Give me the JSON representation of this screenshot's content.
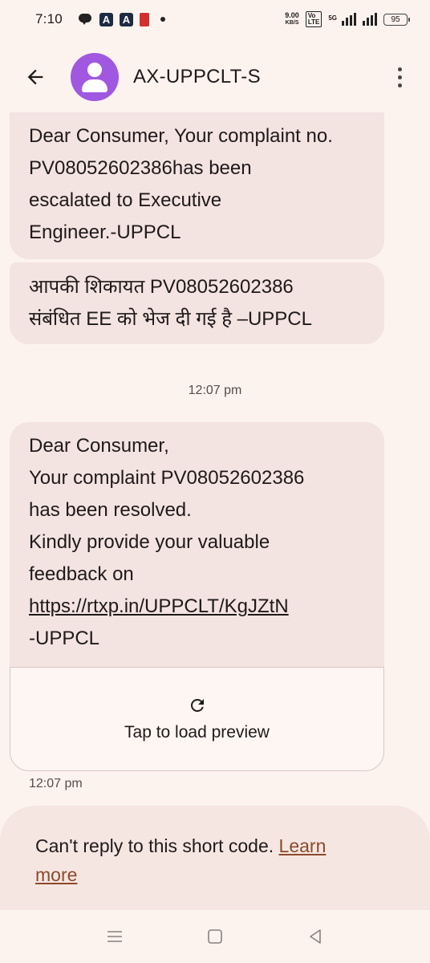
{
  "status_bar": {
    "time": "7:10",
    "net_speed_value": "9.00",
    "net_speed_unit": "KB/S",
    "volte_label_top": "Vo",
    "volte_label_bottom": "LTE",
    "network_type": "5G",
    "battery": "95"
  },
  "header": {
    "contact_name": "AX-UPPCLT-S"
  },
  "messages": {
    "first": {
      "lines": [
        "Dear Consumer, Your complaint no.",
        "PV08052602386has been",
        "escalated to Executive",
        "Engineer.-UPPCL"
      ]
    },
    "second": {
      "lines": [
        "आपकी शिकायत PV08052602386",
        "संबंधित EE को भेज दी गई है –UPPCL"
      ]
    },
    "divider_time": "12:07 pm",
    "third": {
      "lines": [
        "Dear Consumer,",
        "Your complaint PV08052602386",
        "has been resolved.",
        "Kindly provide your valuable",
        "feedback on"
      ],
      "link": "https://rtxp.in/UPPCLT/KgJZtN",
      "signature": "-UPPCL"
    },
    "preview_label": "Tap to load preview",
    "third_time": "12:07 pm"
  },
  "notice": {
    "text": "Can't reply to this short code. ",
    "learn_more_1": "Learn",
    "learn_more_2": "more"
  },
  "colors": {
    "background": "#fcf3ef",
    "bubble": "#f3e3e1",
    "avatar": "#a058e0",
    "link_accent": "#8b4a2b"
  }
}
